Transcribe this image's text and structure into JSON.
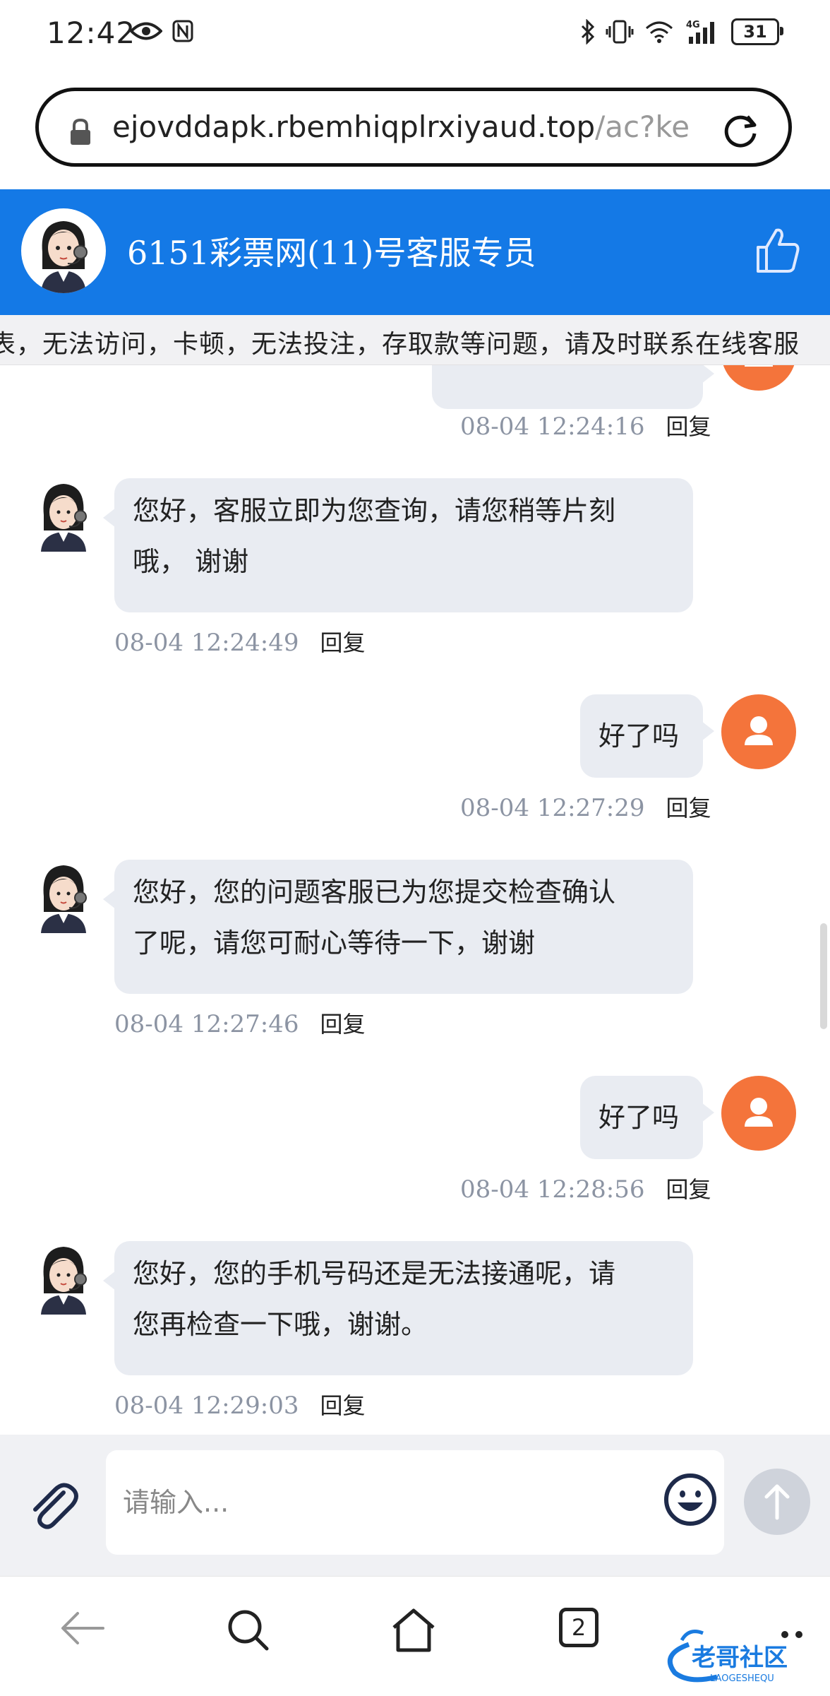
{
  "status_bar": {
    "time": "12:42",
    "battery": "31",
    "network": "4G"
  },
  "browser": {
    "url_host": "ejovddapk.rbemhiqplrxiyaud.top",
    "url_path": "/ac?ke"
  },
  "chat": {
    "title": "6151彩票网(11)号客服专员",
    "notice": "表，无法访问，卡顿，无法投注，存取款等问题，请及时联系在线客服"
  },
  "messages": [
    {
      "sender": "user",
      "text": "",
      "time": "08-04 12:24:16",
      "reply": "回复"
    },
    {
      "sender": "agent",
      "lines": [
        "您好，客服立即为您查询，请您稍等片刻",
        "哦， 谢谢"
      ],
      "time": "08-04 12:24:49",
      "reply": "回复"
    },
    {
      "sender": "user",
      "text": "好了吗",
      "time": "08-04 12:27:29",
      "reply": "回复"
    },
    {
      "sender": "agent",
      "lines": [
        "您好，您的问题客服已为您提交检查确认",
        "了呢，请您可耐心等待一下，谢谢"
      ],
      "time": "08-04 12:27:46",
      "reply": "回复"
    },
    {
      "sender": "user",
      "text": "好了吗",
      "time": "08-04 12:28:56",
      "reply": "回复"
    },
    {
      "sender": "agent",
      "lines": [
        "您好，您的手机号码还是无法接通呢，请",
        "您再检查一下哦，谢谢。"
      ],
      "time": "08-04 12:29:03",
      "reply": "回复"
    }
  ],
  "composer": {
    "placeholder": "请输入..."
  },
  "nav": {
    "tab_count": "2"
  },
  "watermark": {
    "text": "老哥社区",
    "sub": "LAOGESHEQU"
  },
  "colors": {
    "header_blue": "#1479e6",
    "user_avatar_orange": "#f4743b",
    "bubble_gray": "#e9ecf2"
  }
}
